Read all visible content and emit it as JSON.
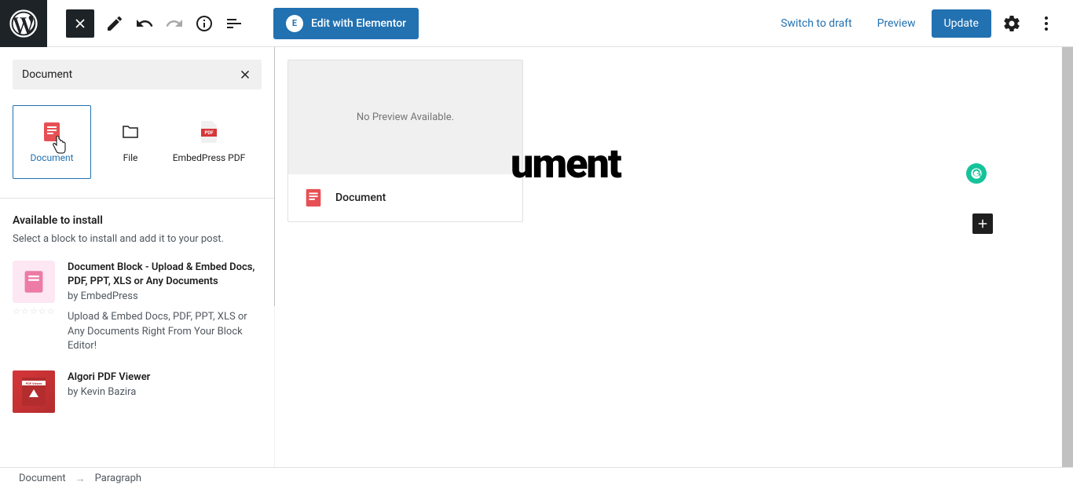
{
  "topbar": {
    "elementor_label": "Edit with Elementor",
    "switch_draft": "Switch to draft",
    "preview": "Preview",
    "update": "Update"
  },
  "inserter": {
    "search_value": "Document",
    "blocks": [
      {
        "label": "Document"
      },
      {
        "label": "File"
      },
      {
        "label": "EmbedPress PDF"
      }
    ],
    "available_title": "Available to install",
    "available_subtitle": "Select a block to install and add it to your post.",
    "plugins": [
      {
        "title": "Document Block - Upload & Embed Docs, PDF, PPT, XLS or Any Documents",
        "author": "by EmbedPress",
        "desc": "Upload & Embed Docs, PDF, PPT, XLS or Any Documents Right From Your Block Editor!"
      },
      {
        "title": "Algori PDF Viewer",
        "author": "by Kevin Bazira",
        "desc": ""
      }
    ]
  },
  "canvas": {
    "no_preview": "No Preview Available.",
    "block_label": "Document",
    "title_fragment": "ument"
  },
  "breadcrumb": {
    "item1": "Document",
    "item2": "Paragraph"
  }
}
